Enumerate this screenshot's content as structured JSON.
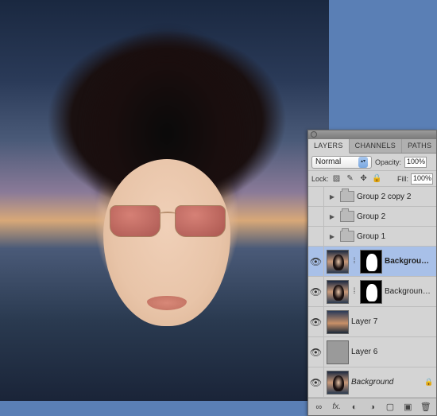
{
  "canvas": {
    "description": "portrait-photo"
  },
  "panel": {
    "tabs": {
      "layers": "LAYERS",
      "channels": "CHANNELS",
      "paths": "PATHS"
    },
    "blend_mode": "Normal",
    "opacity_label": "Opacity:",
    "opacity_value": "100%",
    "lock_label": "Lock:",
    "fill_label": "Fill:",
    "fill_value": "100%",
    "layers": [
      {
        "name": "Group 2 copy 2",
        "type": "group",
        "visible": false
      },
      {
        "name": "Group 2",
        "type": "group",
        "visible": false
      },
      {
        "name": "Group 1",
        "type": "group",
        "visible": false
      },
      {
        "name": "Background cop…",
        "type": "masked",
        "visible": true,
        "selected": true,
        "bold": true
      },
      {
        "name": "Background copy",
        "type": "masked",
        "visible": true
      },
      {
        "name": "Layer 7",
        "type": "image-sky",
        "visible": true
      },
      {
        "name": "Layer 6",
        "type": "image-gray",
        "visible": true
      },
      {
        "name": "Background",
        "type": "image",
        "visible": true,
        "italic": true,
        "locked": true
      }
    ],
    "footer_icons": [
      "link",
      "fx",
      "mask",
      "adj",
      "group",
      "new",
      "trash"
    ]
  }
}
